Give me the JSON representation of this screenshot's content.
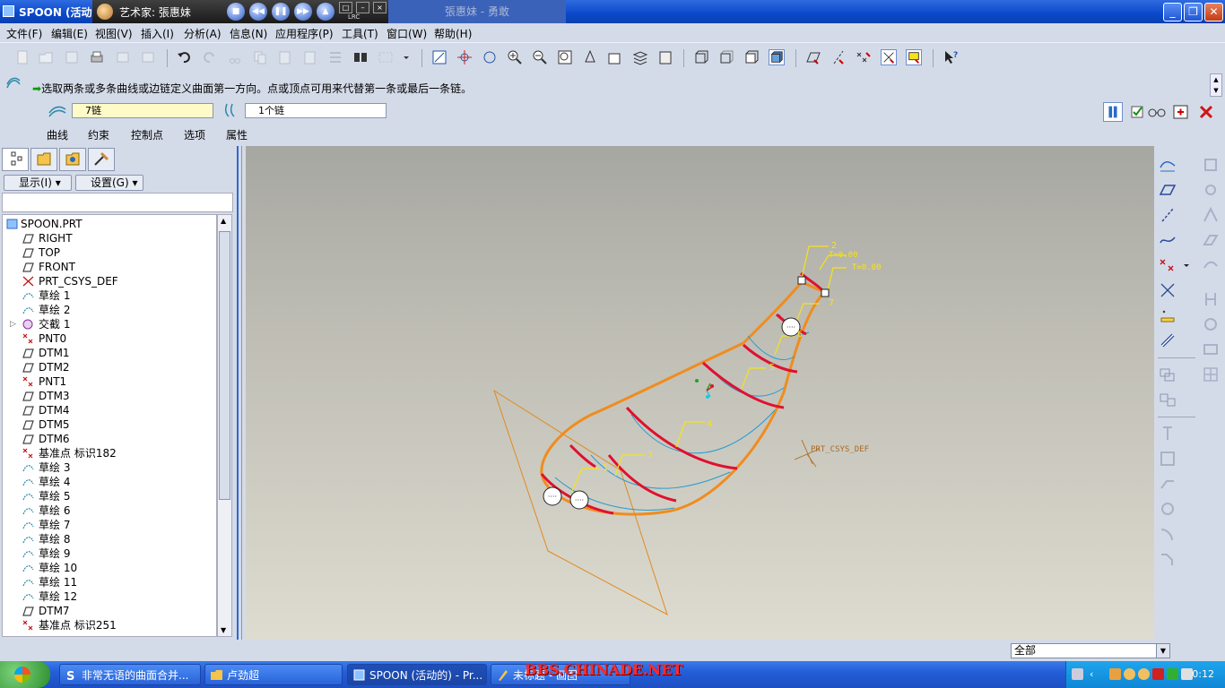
{
  "window": {
    "title": "SPOON (活动的",
    "ghost_title": "張惠妹 - 勇敢"
  },
  "media_player": {
    "now_playing": "艺术家: 張惠妹",
    "lrc": "LRC"
  },
  "menu": [
    "文件(F)",
    "编辑(E)",
    "视图(V)",
    "插入(I)",
    "分析(A)",
    "信息(N)",
    "应用程序(P)",
    "工具(T)",
    "窗口(W)",
    "帮助(H)"
  ],
  "dashboard": {
    "message": "选取两条或多条曲线或边链定义曲面第一方向。点或顶点可用来代替第一条或最后一条链。",
    "first_direction_value": "7链",
    "second_direction_value": "1个链",
    "tabs": [
      "曲线",
      "约束",
      "控制点",
      "选项",
      "属性"
    ]
  },
  "model_tree": {
    "show_label": "显示(I)",
    "settings_label": "设置(G)",
    "items": [
      {
        "label": "SPOON.PRT",
        "icon": "part-icon"
      },
      {
        "label": "RIGHT",
        "icon": "datum-plane-icon"
      },
      {
        "label": "TOP",
        "icon": "datum-plane-icon"
      },
      {
        "label": "FRONT",
        "icon": "datum-plane-icon"
      },
      {
        "label": "PRT_CSYS_DEF",
        "icon": "csys-icon"
      },
      {
        "label": "草绘 1",
        "icon": "sketch-icon"
      },
      {
        "label": "草绘 2",
        "icon": "sketch-icon"
      },
      {
        "label": "交截 1",
        "icon": "intersect-icon"
      },
      {
        "label": "PNT0",
        "icon": "datum-point-icon"
      },
      {
        "label": "DTM1",
        "icon": "datum-plane-icon"
      },
      {
        "label": "DTM2",
        "icon": "datum-plane-icon"
      },
      {
        "label": "PNT1",
        "icon": "datum-point-icon"
      },
      {
        "label": "DTM3",
        "icon": "datum-plane-icon"
      },
      {
        "label": "DTM4",
        "icon": "datum-plane-icon"
      },
      {
        "label": "DTM5",
        "icon": "datum-plane-icon"
      },
      {
        "label": "DTM6",
        "icon": "datum-plane-icon"
      },
      {
        "label": "基准点 标识182",
        "icon": "datum-point-icon"
      },
      {
        "label": "草绘 3",
        "icon": "sketch-icon"
      },
      {
        "label": "草绘 4",
        "icon": "sketch-icon"
      },
      {
        "label": "草绘 5",
        "icon": "sketch-icon"
      },
      {
        "label": "草绘 6",
        "icon": "sketch-icon"
      },
      {
        "label": "草绘 7",
        "icon": "sketch-icon"
      },
      {
        "label": "草绘 8",
        "icon": "sketch-icon"
      },
      {
        "label": "草绘 9",
        "icon": "sketch-icon"
      },
      {
        "label": "草绘 10",
        "icon": "sketch-icon"
      },
      {
        "label": "草绘 11",
        "icon": "sketch-icon"
      },
      {
        "label": "草绘 12",
        "icon": "sketch-icon"
      },
      {
        "label": "DTM7",
        "icon": "datum-plane-icon"
      },
      {
        "label": "基准点 标识251",
        "icon": "datum-point-icon"
      }
    ]
  },
  "viewport": {
    "csys_label": "PRT_CSYS_DEF",
    "t_label_1": "T=0.00",
    "t_label_2": "T=0.00",
    "chain_labels": [
      "2",
      "7",
      "6",
      "5",
      "4",
      "3",
      "1"
    ]
  },
  "status": {
    "filter_value": "全部"
  },
  "taskbar": {
    "buttons": [
      "非常无语的曲面合并...",
      "卢劲超",
      "SPOON (活动的) - Pr...",
      "未标题 - 画图"
    ],
    "watermark": "BBS.CHINADE.NET",
    "clock": "0:12"
  },
  "colors": {
    "titlebar": "#0a48c9",
    "ui_background": "#d4dbe8",
    "surface_edge": "#f08c1e",
    "chain_highlight": "#e01030",
    "label_yellow": "#f5e21a"
  }
}
